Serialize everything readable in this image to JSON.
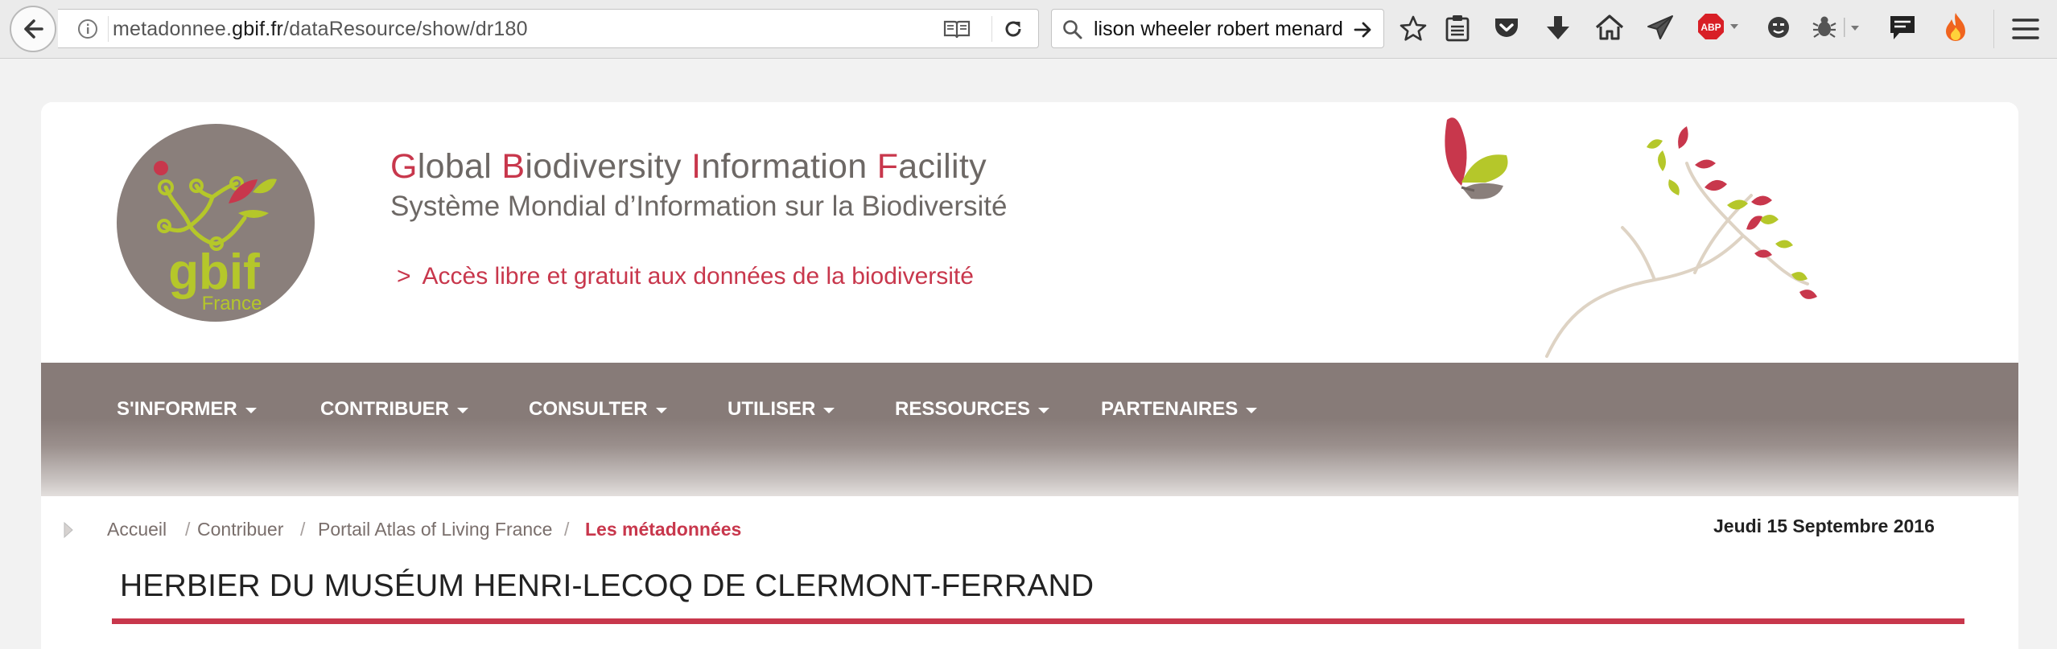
{
  "browser": {
    "url_prefix": "metadonnee.",
    "url_host": "gbif.fr",
    "url_path": "/dataResource/show/dr180",
    "search_query": "lison wheeler robert menard"
  },
  "header": {
    "logo_text": "gbif",
    "logo_subtext": "France",
    "title_en": [
      {
        "cap": "G",
        "rest": "lobal "
      },
      {
        "cap": "B",
        "rest": "iodiversity "
      },
      {
        "cap": "I",
        "rest": "nformation "
      },
      {
        "cap": "F",
        "rest": "acility"
      }
    ],
    "title_fr": "Système Mondial d’Information sur la Biodiversité",
    "tagline_chevron": ">",
    "tagline": "Accès libre et gratuit aux données de la biodiversité"
  },
  "nav": {
    "items": [
      {
        "label": "S'INFORMER"
      },
      {
        "label": "CONTRIBUER"
      },
      {
        "label": "CONSULTER"
      },
      {
        "label": "UTILISER"
      },
      {
        "label": "RESSOURCES"
      },
      {
        "label": "PARTENAIRES"
      }
    ]
  },
  "breadcrumb": {
    "items": [
      "Accueil",
      "Contribuer",
      "Portail Atlas of Living France"
    ],
    "current": "Les métadonnées",
    "separator": "/"
  },
  "date": "Jeudi 15 Septembre 2016",
  "page_title": "HERBIER DU MUSÉUM HENRI-LECOQ DE CLERMONT-FERRAND",
  "colors": {
    "accent_red": "#c8374c",
    "nav_bg": "#877b78",
    "logo_bg": "#8a7f7b",
    "logo_green": "#b5c72a"
  },
  "icons": [
    "back-arrow-icon",
    "info-icon",
    "reader-view-icon",
    "reload-icon",
    "search-icon",
    "go-arrow-icon",
    "bookmark-star-icon",
    "bookmarks-list-icon",
    "pocket-icon",
    "download-icon",
    "home-icon",
    "share-icon",
    "adblock-icon",
    "emoji-icon",
    "bug-icon",
    "chat-icon",
    "fire-icon",
    "hamburger-menu-icon"
  ]
}
